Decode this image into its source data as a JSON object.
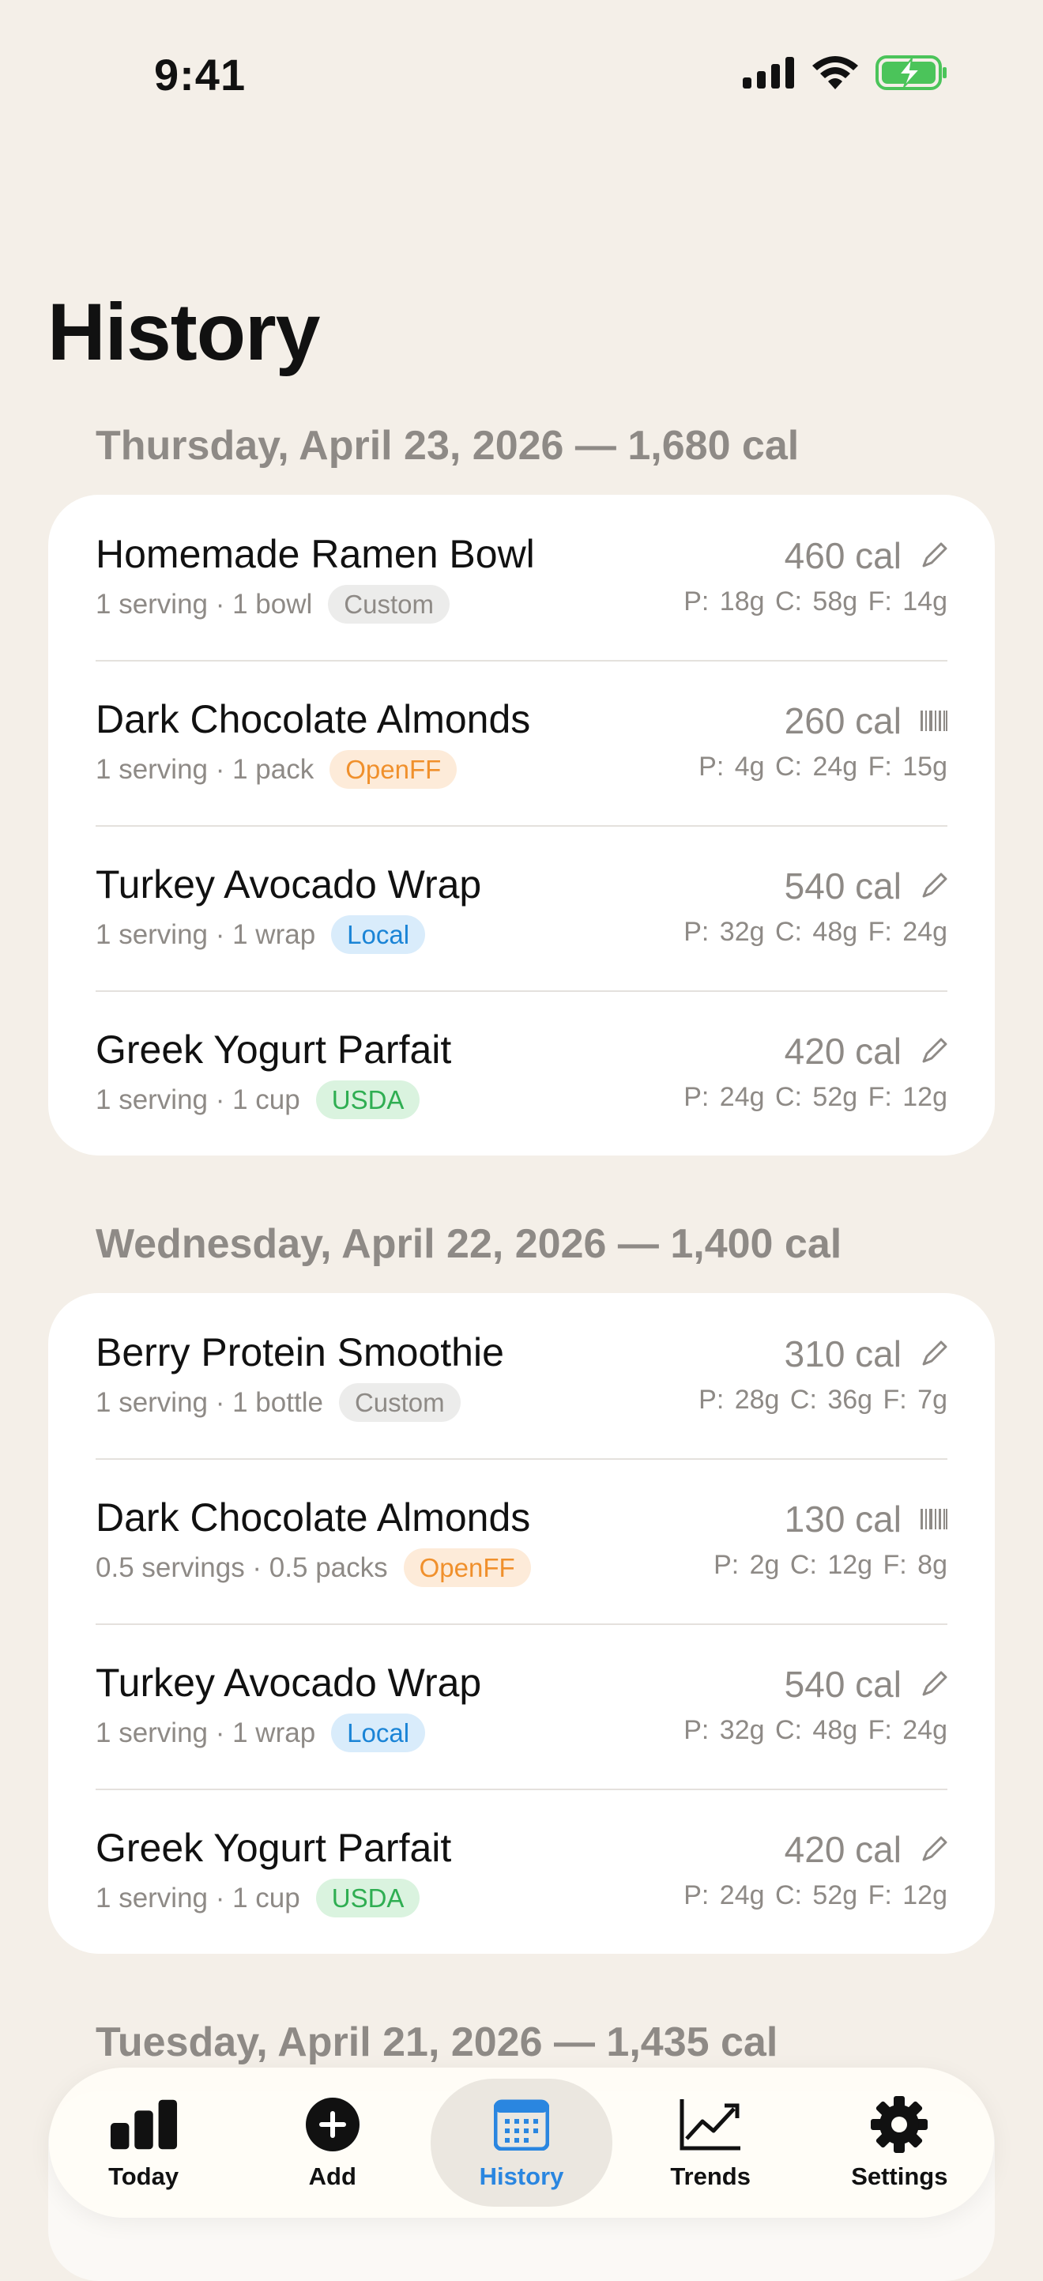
{
  "status_bar": {
    "time": "9:41"
  },
  "page": {
    "title": "History"
  },
  "days": [
    {
      "header": "Thursday, April 23, 2026 — 1,680 cal",
      "entries": [
        {
          "name": "Homemade Ramen Bowl",
          "meta": "1 serving · 1 bowl",
          "source": "Custom",
          "calories": "460 cal",
          "macros": "P: 18g  C: 58g  F: 14g",
          "icon": "pencil-icon"
        },
        {
          "name": "Dark Chocolate Almonds",
          "meta": "1 serving · 1 pack",
          "source": "OpenFF",
          "calories": "260 cal",
          "macros": "P: 4g  C: 24g  F: 15g",
          "icon": "barcode-icon"
        },
        {
          "name": "Turkey Avocado Wrap",
          "meta": "1 serving · 1 wrap",
          "source": "Local",
          "calories": "540 cal",
          "macros": "P: 32g  C: 48g  F: 24g",
          "icon": "pencil-icon"
        },
        {
          "name": "Greek Yogurt Parfait",
          "meta": "1 serving · 1 cup",
          "source": "USDA",
          "calories": "420 cal",
          "macros": "P: 24g  C: 52g  F: 12g",
          "icon": "pencil-icon"
        }
      ]
    },
    {
      "header": "Wednesday, April 22, 2026 — 1,400 cal",
      "entries": [
        {
          "name": "Berry Protein Smoothie",
          "meta": "1 serving · 1 bottle",
          "source": "Custom",
          "calories": "310 cal",
          "macros": "P: 28g  C: 36g  F: 7g",
          "icon": "pencil-icon"
        },
        {
          "name": "Dark Chocolate Almonds",
          "meta": "0.5 servings · 0.5 packs",
          "source": "OpenFF",
          "calories": "130 cal",
          "macros": "P: 2g  C: 12g  F: 8g",
          "icon": "barcode-icon"
        },
        {
          "name": "Turkey Avocado Wrap",
          "meta": "1 serving · 1 wrap",
          "source": "Local",
          "calories": "540 cal",
          "macros": "P: 32g  C: 48g  F: 24g",
          "icon": "pencil-icon"
        },
        {
          "name": "Greek Yogurt Parfait",
          "meta": "1 serving · 1 cup",
          "source": "USDA",
          "calories": "420 cal",
          "macros": "P: 24g  C: 52g  F: 12g",
          "icon": "pencil-icon"
        }
      ]
    },
    {
      "header": "Tuesday, April 21, 2026 — 1,435 cal"
    }
  ],
  "tabs": [
    {
      "label": "Today",
      "icon": "bar-chart-icon",
      "active": false
    },
    {
      "label": "Add",
      "icon": "plus-circle-icon",
      "active": false
    },
    {
      "label": "History",
      "icon": "calendar-icon",
      "active": true
    },
    {
      "label": "Trends",
      "icon": "trend-line-icon",
      "active": false
    },
    {
      "label": "Settings",
      "icon": "gear-icon",
      "active": false
    }
  ],
  "colors": {
    "background": "#f4efe8",
    "accent": "#2a86e0",
    "badge_custom": "#8e8a86",
    "badge_openff": "#f0902c",
    "badge_local": "#1a84d6",
    "badge_usda": "#2fae52"
  }
}
